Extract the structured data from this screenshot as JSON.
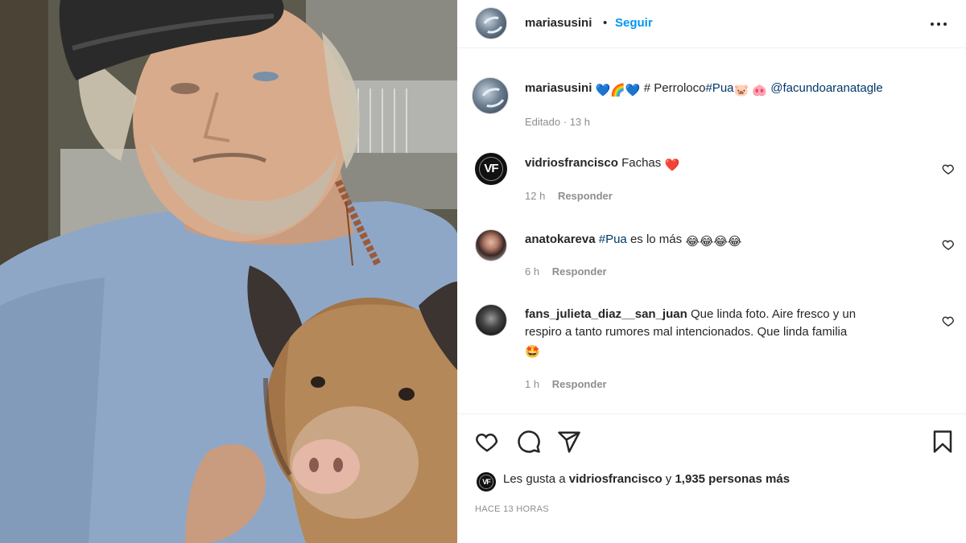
{
  "post": {
    "author": "mariasusini",
    "follow_label": "Seguir",
    "separator": "•",
    "photo_description_icon": "photo-icon"
  },
  "caption": {
    "username": "mariasusini",
    "emoji_prefix": "💙🌈💙",
    "hash": "#",
    "text": "Perroloco",
    "hashtag": "#Pua",
    "emoji_mid": "🐷",
    "emoji_end": "🐽",
    "mention": "@facundoaranatagle",
    "edited_label": "Editado",
    "dot": "·",
    "time": "13 h"
  },
  "comments": [
    {
      "username": "vidriosfrancisco",
      "text": "Fachas",
      "emoji": "❤️",
      "time": "12 h",
      "reply_label": "Responder",
      "avatar_text": "VF"
    },
    {
      "username": "anatokareva",
      "hashtag": "#Pua",
      "text": "es lo más",
      "emoji": "😂😂😂😂",
      "time": "6 h",
      "reply_label": "Responder"
    },
    {
      "username": "fans_julieta_diaz__san_juan",
      "text_line1": "Que linda foto. Aire fresco y un",
      "text_line2": "respiro a tanto rumores mal intencionados. Que linda familia",
      "emoji": "🤩",
      "time": "1 h",
      "reply_label": "Responder"
    }
  ],
  "likes": {
    "prefix": "Les gusta a",
    "user": "vidriosfrancisco",
    "conj": "y",
    "count_text": "1,935 personas más",
    "avatar_text": "VF"
  },
  "time_ago": "HACE 13 HORAS",
  "icons": {
    "like": "heart-icon",
    "comment": "comment-icon",
    "share": "paper-plane-icon",
    "save": "bookmark-icon",
    "more": "more-options-icon"
  },
  "colors": {
    "link": "#0095f6",
    "tag": "#00376b",
    "muted": "#8e8e8e",
    "text": "#262626"
  }
}
